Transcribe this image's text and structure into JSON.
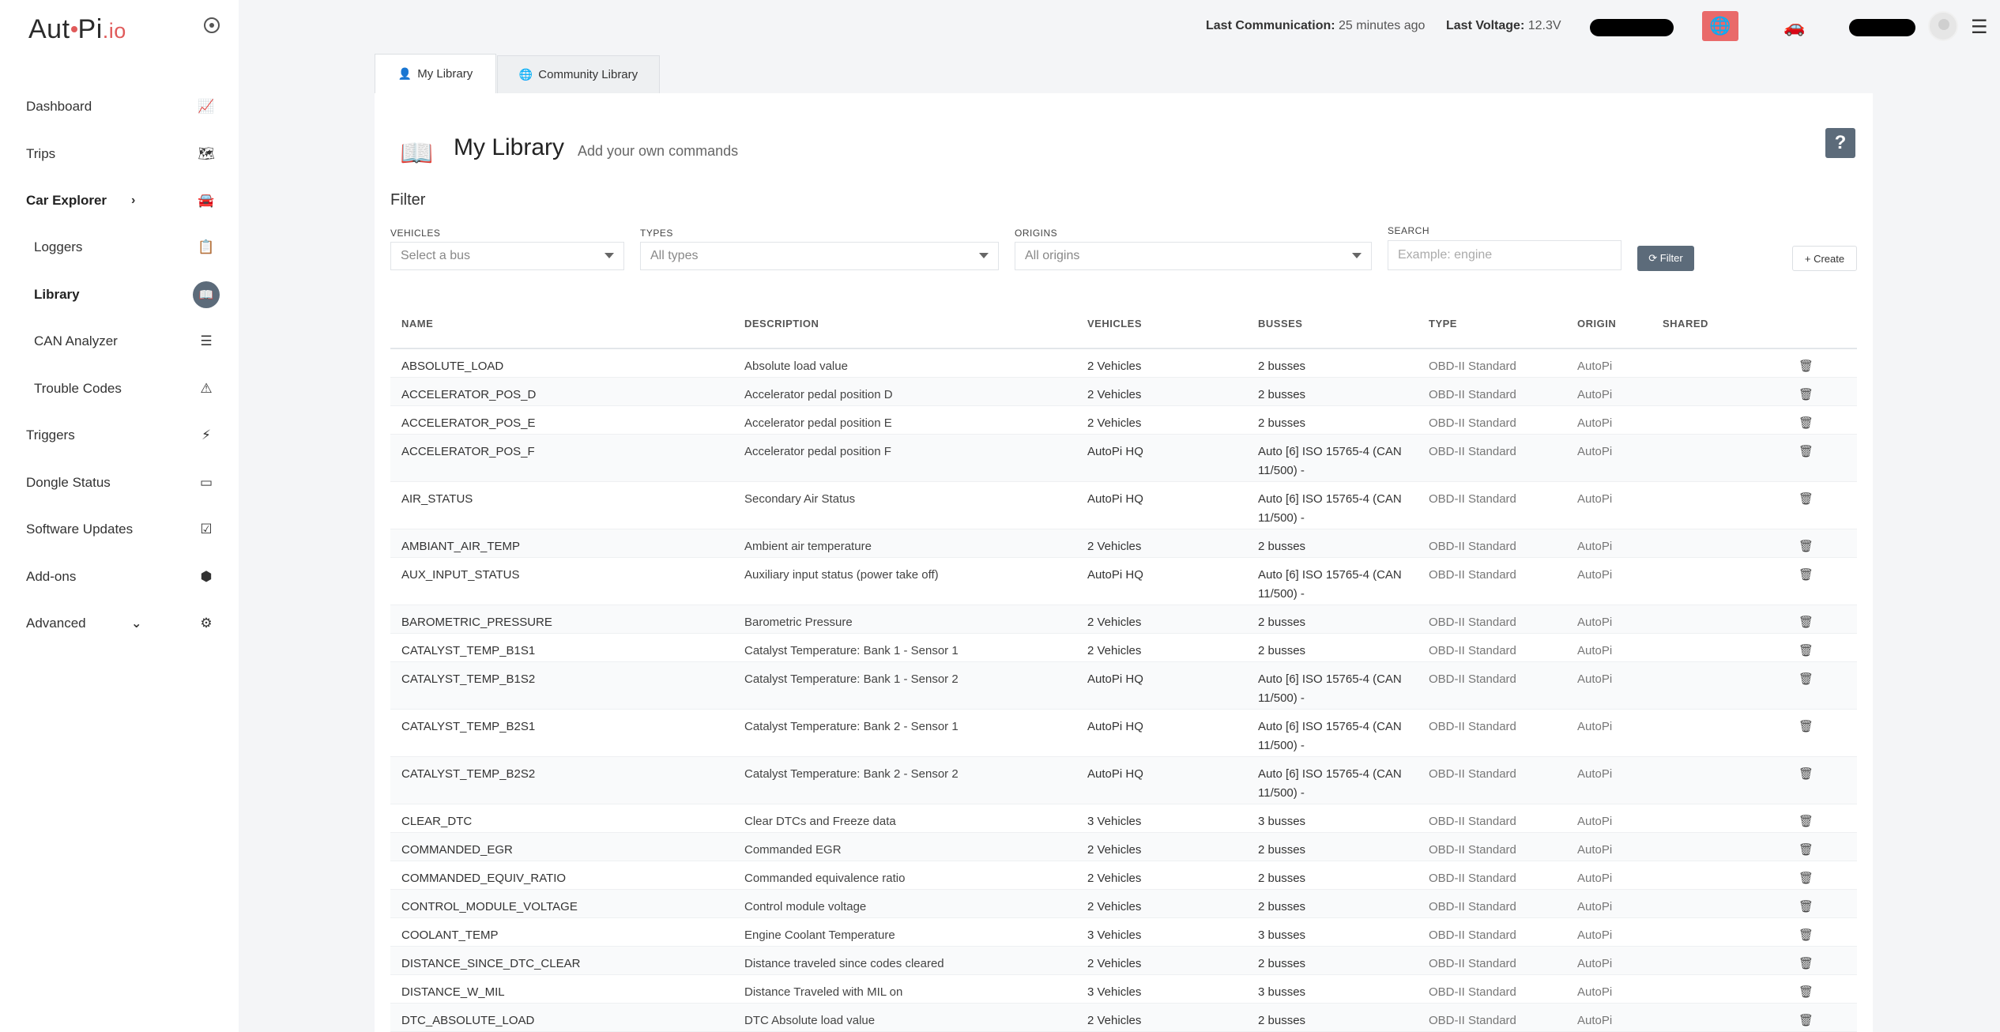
{
  "logo": {
    "main_a": "Aut",
    "main_b": "Pi",
    "suffix": ".io"
  },
  "sidebar": {
    "items": [
      {
        "label": "Dashboard",
        "icon": "chart-icon",
        "glyph": "📈"
      },
      {
        "label": "Trips",
        "icon": "map-icon",
        "glyph": "🗺"
      },
      {
        "label": "Car Explorer",
        "icon": "car-icon",
        "glyph": "🚘",
        "chevron": "›"
      },
      {
        "label": "Loggers",
        "icon": "clipboard-icon",
        "glyph": "📋"
      },
      {
        "label": "Library",
        "icon": "library-icon",
        "glyph": "📖"
      },
      {
        "label": "CAN Analyzer",
        "icon": "sliders-icon",
        "glyph": "☰"
      },
      {
        "label": "Trouble Codes",
        "icon": "car-crash-icon",
        "glyph": "⚠"
      },
      {
        "label": "Triggers",
        "icon": "bolt-icon",
        "glyph": "⚡"
      },
      {
        "label": "Dongle Status",
        "icon": "battery-icon",
        "glyph": "▭"
      },
      {
        "label": "Software Updates",
        "icon": "check-square-icon",
        "glyph": "☑"
      },
      {
        "label": "Add-ons",
        "icon": "cubes-icon",
        "glyph": "⬢"
      },
      {
        "label": "Advanced",
        "icon": "cogs-icon",
        "glyph": "⚙",
        "chevron": "⌄"
      }
    ]
  },
  "topbar": {
    "comm_label": "Last Communication:",
    "comm_value": "25 minutes ago",
    "volt_label": "Last Voltage:",
    "volt_value": "12.3V",
    "globe_glyph": "🌐",
    "car_glyph": "🚗",
    "menu_glyph": "☰"
  },
  "tabs": {
    "my_library": "My Library",
    "community_library": "Community Library"
  },
  "header": {
    "title": "My Library",
    "subtitle": "Add your own commands",
    "help": "?"
  },
  "filter": {
    "title": "Filter",
    "vehicles_label": "VEHICLES",
    "vehicles_value": "Select a bus",
    "types_label": "TYPES",
    "types_value": "All types",
    "origins_label": "ORIGINS",
    "origins_value": "All origins",
    "search_label": "SEARCH",
    "search_placeholder": "Example: engine",
    "filter_button": "⟳ Filter",
    "create_button": "+ Create"
  },
  "table": {
    "headers": [
      "NAME",
      "DESCRIPTION",
      "VEHICLES",
      "BUSSES",
      "TYPE",
      "ORIGIN",
      "SHARED"
    ],
    "rows": [
      {
        "name": "ABSOLUTE_LOAD",
        "description": "Absolute load value",
        "vehicles": "2 Vehicles",
        "busses": "2 busses",
        "type": "OBD-II Standard",
        "origin": "AutoPi"
      },
      {
        "name": "ACCELERATOR_POS_D",
        "description": "Accelerator pedal position D",
        "vehicles": "2 Vehicles",
        "busses": "2 busses",
        "type": "OBD-II Standard",
        "origin": "AutoPi"
      },
      {
        "name": "ACCELERATOR_POS_E",
        "description": "Accelerator pedal position E",
        "vehicles": "2 Vehicles",
        "busses": "2 busses",
        "type": "OBD-II Standard",
        "origin": "AutoPi"
      },
      {
        "name": "ACCELERATOR_POS_F",
        "description": "Accelerator pedal position F",
        "vehicles": "AutoPi HQ",
        "busses": "Auto [6] ISO 15765-4 (CAN 11/500) -",
        "type": "OBD-II Standard",
        "origin": "AutoPi"
      },
      {
        "name": "AIR_STATUS",
        "description": "Secondary Air Status",
        "vehicles": "AutoPi HQ",
        "busses": "Auto [6] ISO 15765-4 (CAN 11/500) -",
        "type": "OBD-II Standard",
        "origin": "AutoPi"
      },
      {
        "name": "AMBIANT_AIR_TEMP",
        "description": "Ambient air temperature",
        "vehicles": "2 Vehicles",
        "busses": "2 busses",
        "type": "OBD-II Standard",
        "origin": "AutoPi"
      },
      {
        "name": "AUX_INPUT_STATUS",
        "description": "Auxiliary input status (power take off)",
        "vehicles": "AutoPi HQ",
        "busses": "Auto [6] ISO 15765-4 (CAN 11/500) -",
        "type": "OBD-II Standard",
        "origin": "AutoPi"
      },
      {
        "name": "BAROMETRIC_PRESSURE",
        "description": "Barometric Pressure",
        "vehicles": "2 Vehicles",
        "busses": "2 busses",
        "type": "OBD-II Standard",
        "origin": "AutoPi"
      },
      {
        "name": "CATALYST_TEMP_B1S1",
        "description": "Catalyst Temperature: Bank 1 - Sensor 1",
        "vehicles": "2 Vehicles",
        "busses": "2 busses",
        "type": "OBD-II Standard",
        "origin": "AutoPi"
      },
      {
        "name": "CATALYST_TEMP_B1S2",
        "description": "Catalyst Temperature: Bank 1 - Sensor 2",
        "vehicles": "AutoPi HQ",
        "busses": "Auto [6] ISO 15765-4 (CAN 11/500) -",
        "type": "OBD-II Standard",
        "origin": "AutoPi"
      },
      {
        "name": "CATALYST_TEMP_B2S1",
        "description": "Catalyst Temperature: Bank 2 - Sensor 1",
        "vehicles": "AutoPi HQ",
        "busses": "Auto [6] ISO 15765-4 (CAN 11/500) -",
        "type": "OBD-II Standard",
        "origin": "AutoPi"
      },
      {
        "name": "CATALYST_TEMP_B2S2",
        "description": "Catalyst Temperature: Bank 2 - Sensor 2",
        "vehicles": "AutoPi HQ",
        "busses": "Auto [6] ISO 15765-4 (CAN 11/500) -",
        "type": "OBD-II Standard",
        "origin": "AutoPi"
      },
      {
        "name": "CLEAR_DTC",
        "description": "Clear DTCs and Freeze data",
        "vehicles": "3 Vehicles",
        "busses": "3 busses",
        "type": "OBD-II Standard",
        "origin": "AutoPi"
      },
      {
        "name": "COMMANDED_EGR",
        "description": "Commanded EGR",
        "vehicles": "2 Vehicles",
        "busses": "2 busses",
        "type": "OBD-II Standard",
        "origin": "AutoPi"
      },
      {
        "name": "COMMANDED_EQUIV_RATIO",
        "description": "Commanded equivalence ratio",
        "vehicles": "2 Vehicles",
        "busses": "2 busses",
        "type": "OBD-II Standard",
        "origin": "AutoPi"
      },
      {
        "name": "CONTROL_MODULE_VOLTAGE",
        "description": "Control module voltage",
        "vehicles": "2 Vehicles",
        "busses": "2 busses",
        "type": "OBD-II Standard",
        "origin": "AutoPi"
      },
      {
        "name": "COOLANT_TEMP",
        "description": "Engine Coolant Temperature",
        "vehicles": "3 Vehicles",
        "busses": "3 busses",
        "type": "OBD-II Standard",
        "origin": "AutoPi"
      },
      {
        "name": "DISTANCE_SINCE_DTC_CLEAR",
        "description": "Distance traveled since codes cleared",
        "vehicles": "2 Vehicles",
        "busses": "2 busses",
        "type": "OBD-II Standard",
        "origin": "AutoPi"
      },
      {
        "name": "DISTANCE_W_MIL",
        "description": "Distance Traveled with MIL on",
        "vehicles": "3 Vehicles",
        "busses": "3 busses",
        "type": "OBD-II Standard",
        "origin": "AutoPi"
      },
      {
        "name": "DTC_ABSOLUTE_LOAD",
        "description": "DTC Absolute load value",
        "vehicles": "2 Vehicles",
        "busses": "2 busses",
        "type": "OBD-II Standard",
        "origin": "AutoPi"
      }
    ]
  }
}
